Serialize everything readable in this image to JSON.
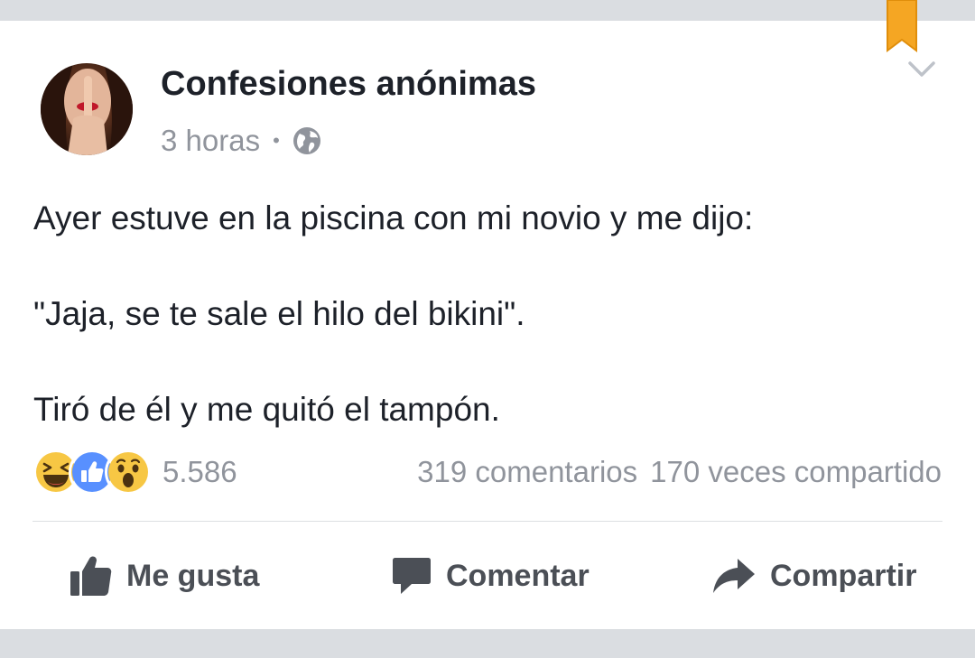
{
  "post": {
    "page_name": "Confesiones anónimas",
    "timestamp": "3 horas",
    "separator": "•",
    "privacy_icon": "globe-icon",
    "lines": [
      "Ayer estuve en la piscina con mi novio y me dijo:",
      "\"Jaja, se te sale el hilo del bikini\".",
      "Tiró de él y me quitó el tampón."
    ]
  },
  "engagement": {
    "reactions": [
      "haha-reaction-icon",
      "like-reaction-icon",
      "wow-reaction-icon"
    ],
    "reaction_count": "5.586",
    "comments": "319 comentarios",
    "shares": "170 veces compartido"
  },
  "actions": {
    "like": "Me gusta",
    "comment": "Comentar",
    "share": "Compartir"
  },
  "colors": {
    "text": "#1d2129",
    "muted": "#90949c",
    "action": "#4b4f56",
    "like_blue": "#5890ff",
    "reaction_yellow": "#f7c744",
    "bookmark": "#f5a623"
  }
}
